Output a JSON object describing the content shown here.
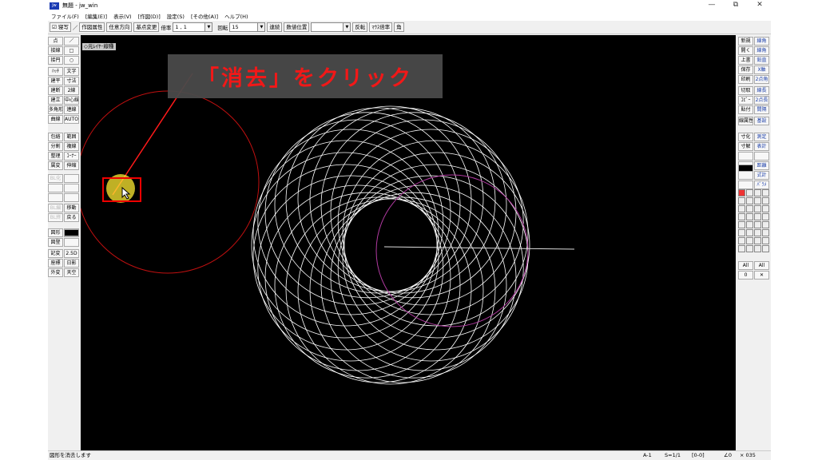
{
  "window": {
    "title": "無題 - jw_win",
    "icon_text": "Jw",
    "minimize": "—",
    "maximize": "⧉",
    "close": "✕"
  },
  "menu": [
    "ファイル(F)",
    "[編集(E)]",
    "表示(V)",
    "[作図(D)]",
    "設定(S)",
    "[その他(A)]",
    "ヘルプ(H)"
  ],
  "toolbar": {
    "check_label": "寝写",
    "slash_label": "／",
    "attr_btn": "作図属性",
    "dir_btn": "任意方向",
    "base_btn": "基点変更",
    "scale_label": "倍率",
    "scale_value": "1 , 1",
    "rotate_label": "回転",
    "rotate_value": "15",
    "continuous_btn": "連続",
    "numeric_btn": "数値位置",
    "flip_btn": "反転",
    "mouse_btn": "ﾏｳｽ倍率",
    "angle_btn": "角"
  },
  "left_palette": [
    [
      "点",
      "／"
    ],
    [
      "接線",
      "□"
    ],
    [
      "接円",
      "○"
    ],
    [
      "ﾊｯﾁ",
      "文字"
    ],
    [
      "建平",
      "寸法"
    ],
    [
      "建断",
      "2線"
    ],
    [
      "建立",
      "中心線"
    ],
    [
      "多角形",
      "連線"
    ],
    [
      "曲線",
      "AUTO"
    ],
    [
      "包絡",
      "範囲"
    ],
    [
      "分割",
      "複線"
    ],
    [
      "整理",
      "ｺｰﾅｰ"
    ],
    [
      "属変",
      "伸縮"
    ],
    [
      "BL化",
      ""
    ],
    [
      "",
      ""
    ],
    [
      "",
      ""
    ],
    [
      "BL編",
      "移動"
    ],
    [
      "BL終",
      "戻る"
    ],
    [
      "図形",
      ""
    ],
    [
      "図登",
      ""
    ],
    [
      "記変",
      "2.5D"
    ],
    [
      "座標",
      "日影"
    ],
    [
      "外変",
      "天空"
    ]
  ],
  "left_dim": [
    "BL化",
    "BL編",
    "BL終"
  ],
  "right_palette": [
    [
      "新規",
      "線角"
    ],
    [
      "開く",
      "線角"
    ],
    [
      "上書",
      "鉛直"
    ],
    [
      "保存",
      "X軸"
    ],
    [
      "印刷",
      "2点角"
    ],
    [
      "切取",
      "線長"
    ],
    [
      "ｺﾋﾟｰ",
      "2点長"
    ],
    [
      "貼付",
      "間隔"
    ],
    [
      "線属性",
      "基設"
    ],
    [
      "寸化",
      "測定"
    ],
    [
      "寸解",
      "表計"
    ],
    [
      "",
      ""
    ],
    [
      "",
      "距離"
    ],
    [
      "",
      "式計"
    ],
    [
      "",
      "ﾊﾟﾗﾒ"
    ]
  ],
  "right_bottom": [
    "All",
    "All",
    "0",
    "✕"
  ],
  "canvas": {
    "layer_label": "◇元ﾚｲﾔ･線種"
  },
  "callout": {
    "text": "「消去」をクリック"
  },
  "status": {
    "message": "図形を消去します",
    "cells": [
      "A-1",
      "S=1/1",
      "[0-0]",
      "∠0",
      "× 035"
    ]
  },
  "colors": {
    "callout_text": "#ff1a1a",
    "drawing_lines": "#ffffff",
    "highlight": "#e00000",
    "canvas_bg": "#000000",
    "magenta_circle": "#b03aa0"
  }
}
